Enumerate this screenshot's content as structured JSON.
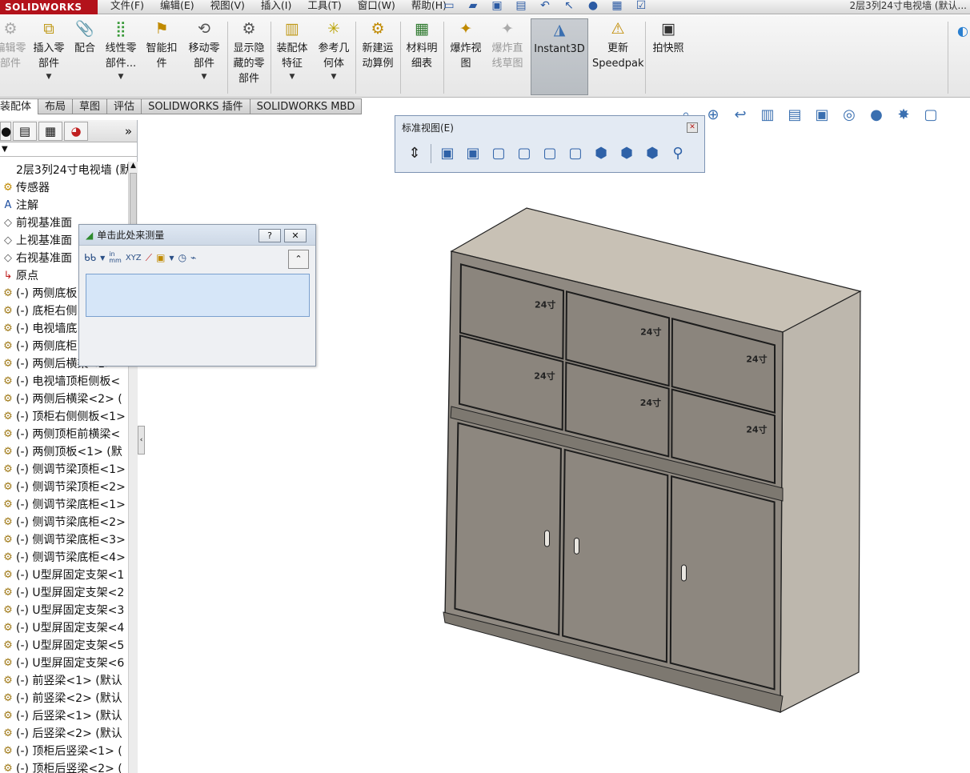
{
  "app": {
    "brand": "SOLIDWORKS",
    "document_title": "2层3列24寸电视墙 (默认..."
  },
  "menu": [
    "文件(F)",
    "编辑(E)",
    "视图(V)",
    "插入(I)",
    "工具(T)",
    "窗口(W)",
    "帮助(H)"
  ],
  "command_manager": [
    {
      "label": "编辑零\n部件",
      "icon": "edit-component-icon",
      "state": "disabled"
    },
    {
      "label": "插入零\n部件",
      "icon": "insert-components-icon",
      "state": "normal",
      "dropdown": true
    },
    {
      "label": "配合",
      "icon": "mate-icon",
      "state": "normal"
    },
    {
      "label": "线性零\n部件...",
      "icon": "linear-pattern-icon",
      "state": "normal",
      "dropdown": true
    },
    {
      "label": "智能扣\n件",
      "icon": "smart-fasteners-icon",
      "state": "normal"
    },
    {
      "label": "移动零\n部件",
      "icon": "move-component-icon",
      "state": "normal",
      "dropdown": true
    },
    {
      "label": "显示隐\n藏的零\n部件",
      "icon": "show-hidden-components-icon",
      "state": "normal"
    },
    {
      "label": "装配体\n特征",
      "icon": "assembly-features-icon",
      "state": "normal",
      "dropdown": true
    },
    {
      "label": "参考几\n何体",
      "icon": "reference-geometry-icon",
      "state": "normal",
      "dropdown": true
    },
    {
      "label": "新建运\n动算例",
      "icon": "new-motion-study-icon",
      "state": "normal"
    },
    {
      "label": "材料明\n细表",
      "icon": "bill-of-materials-icon",
      "state": "normal"
    },
    {
      "label": "爆炸视\n图",
      "icon": "exploded-view-icon",
      "state": "normal"
    },
    {
      "label": "爆炸直\n线草图",
      "icon": "explode-line-sketch-icon",
      "state": "disabled"
    },
    {
      "label": "Instant3D",
      "icon": "instant3d-icon",
      "state": "active"
    },
    {
      "label": "更新\nSpeedpak",
      "icon": "update-speedpak-icon",
      "state": "normal"
    },
    {
      "label": "拍快照",
      "icon": "snapshot-icon",
      "state": "normal"
    }
  ],
  "tabs": [
    "装配体",
    "布局",
    "草图",
    "评估",
    "SOLIDWORKS 插件",
    "SOLIDWORKS MBD"
  ],
  "active_tab": "装配体",
  "feature_tree": {
    "root": "2层3列24寸电视墙 (默认",
    "items": [
      {
        "icon": "sensor",
        "label": "传感器"
      },
      {
        "icon": "note",
        "label": "注解"
      },
      {
        "icon": "plane",
        "label": "前视基准面"
      },
      {
        "icon": "plane",
        "label": "上视基准面"
      },
      {
        "icon": "plane",
        "label": "右视基准面"
      },
      {
        "icon": "origin",
        "label": "原点"
      },
      {
        "icon": "part",
        "label": "(-) 两侧底板"
      },
      {
        "icon": "part",
        "label": "(-) 底柜右侧"
      },
      {
        "icon": "part",
        "label": "(-) 电视墙底"
      },
      {
        "icon": "part",
        "label": "(-) 两侧底柜"
      },
      {
        "icon": "part",
        "label": "(-) 两侧后横梁<1>"
      },
      {
        "icon": "part",
        "label": "(-) 电视墙顶柜侧板<"
      },
      {
        "icon": "part",
        "label": "(-) 两侧后横梁<2> ("
      },
      {
        "icon": "part",
        "label": "(-) 顶柜右侧侧板<1>"
      },
      {
        "icon": "part",
        "label": "(-) 两侧顶柜前横梁<"
      },
      {
        "icon": "part",
        "label": "(-) 两侧顶板<1> (默"
      },
      {
        "icon": "part",
        "label": "(-) 侧调节梁顶柜<1>"
      },
      {
        "icon": "part",
        "label": "(-) 侧调节梁顶柜<2>"
      },
      {
        "icon": "part",
        "label": "(-) 侧调节梁底柜<1>"
      },
      {
        "icon": "part",
        "label": "(-) 侧调节梁底柜<2>"
      },
      {
        "icon": "part",
        "label": "(-) 侧调节梁底柜<3>"
      },
      {
        "icon": "part",
        "label": "(-) 侧调节梁底柜<4>"
      },
      {
        "icon": "part",
        "label": "(-) U型屏固定支架<1"
      },
      {
        "icon": "part",
        "label": "(-) U型屏固定支架<2"
      },
      {
        "icon": "part",
        "label": "(-) U型屏固定支架<3"
      },
      {
        "icon": "part",
        "label": "(-) U型屏固定支架<4"
      },
      {
        "icon": "part",
        "label": "(-) U型屏固定支架<5"
      },
      {
        "icon": "part",
        "label": "(-) U型屏固定支架<6"
      },
      {
        "icon": "part",
        "label": "(-) 前竖梁<1> (默认"
      },
      {
        "icon": "part",
        "label": "(-) 前竖梁<2> (默认"
      },
      {
        "icon": "part",
        "label": "(-) 后竖梁<1> (默认"
      },
      {
        "icon": "part",
        "label": "(-) 后竖梁<2> (默认"
      },
      {
        "icon": "part",
        "label": "(-) 顶柜后竖梁<1> ("
      },
      {
        "icon": "part",
        "label": "(-) 顶柜后竖梁<2> ("
      }
    ]
  },
  "measure_dialog": {
    "title": "单击此处来测量",
    "help": "?",
    "close": "✕",
    "units_label": "in\nmm",
    "xyz_label": "XYZ",
    "result": ""
  },
  "standard_views": {
    "title": "标准视图(E)",
    "buttons": [
      "normal-to",
      "front",
      "back",
      "left",
      "right",
      "top",
      "bottom",
      "isometric",
      "trimetric",
      "dimetric",
      "link-view"
    ]
  },
  "model": {
    "screen_label": "24寸",
    "upper_cells": 6,
    "lower_doors": 3,
    "body_color": "#8f8981",
    "top_color": "#c8c1b5",
    "side_color": "#bdb7ad"
  }
}
